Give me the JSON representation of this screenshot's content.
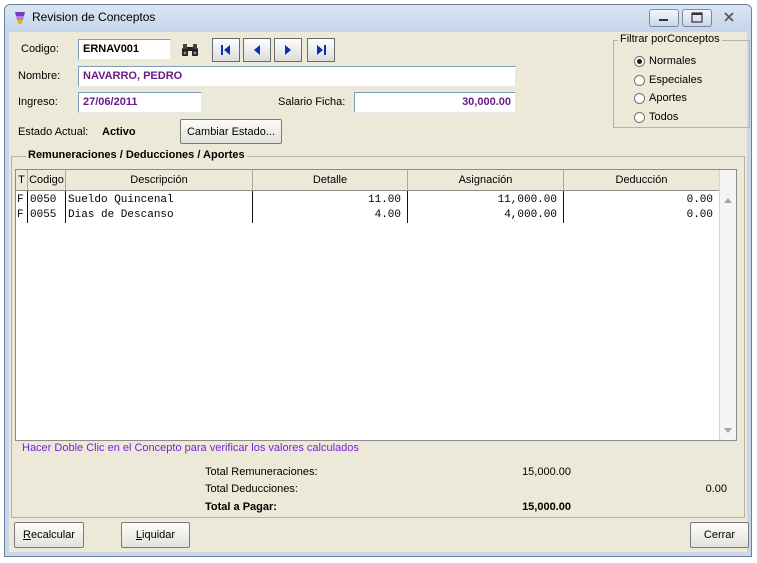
{
  "window": {
    "title": "Revision de Conceptos"
  },
  "form": {
    "codigo_label": "Codigo:",
    "codigo_value": "ERNAV001",
    "nombre_label": "Nombre:",
    "nombre_value": "NAVARRO, PEDRO",
    "ingreso_label": "Ingreso:",
    "ingreso_value": "27/06/2011",
    "salario_label": "Salario Ficha:",
    "salario_value": "30,000.00",
    "estado_label": "Estado Actual:",
    "estado_value": "Activo",
    "cambiar_estado_label": "Cambiar Estado..."
  },
  "filter": {
    "title": "Filtrar porConceptos",
    "options": [
      {
        "label": "Normales",
        "selected": true
      },
      {
        "label": "Especiales",
        "selected": false
      },
      {
        "label": "Aportes",
        "selected": false
      },
      {
        "label": "Todos",
        "selected": false
      }
    ]
  },
  "grid": {
    "title": "Remuneraciones / Deducciones / Aportes",
    "columns": [
      "T",
      "Codigo",
      "Descripción",
      "Detalle",
      "Asignación",
      "Deducción"
    ],
    "rows": [
      {
        "t": "F",
        "codigo": "0050",
        "descripcion": "Sueldo Quincenal",
        "detalle": "11.00",
        "asignacion": "11,000.00",
        "deduccion": "0.00"
      },
      {
        "t": "F",
        "codigo": "0055",
        "descripcion": "Dias de Descanso",
        "detalle": "4.00",
        "asignacion": "4,000.00",
        "deduccion": "0.00"
      }
    ],
    "hint": "Hacer Doble Clic en el Concepto para verificar los valores calculados"
  },
  "totals": {
    "remuneraciones_label": "Total Remuneraciones:",
    "remuneraciones_value": "15,000.00",
    "deducciones_label": "Total Deducciones:",
    "deducciones_value": "0.00",
    "pagar_label": "Total a Pagar:",
    "pagar_value": "15,000.00"
  },
  "buttons": {
    "recalcular_first": "R",
    "recalcular_rest": "ecalcular",
    "liquidar_first": "L",
    "liquidar_rest": "iquidar",
    "cerrar": "Cerrar"
  },
  "icons": {
    "search": "binoculars-icon",
    "first": "first-record-icon",
    "prev": "previous-record-icon",
    "next": "next-record-icon",
    "last": "last-record-icon"
  },
  "colors": {
    "value_purple": "#6a1b86",
    "hint_purple": "#7a1fe0",
    "nav_blue": "#0a2fb0"
  }
}
